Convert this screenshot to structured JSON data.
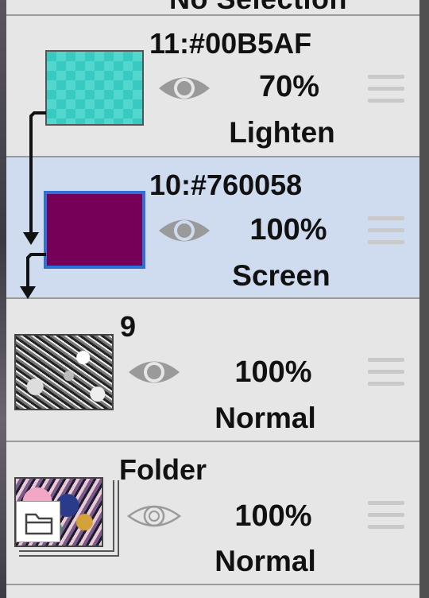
{
  "header_partial_text": "No Selection",
  "layers": [
    {
      "name": "11:#00B5AF",
      "opacity": "70%",
      "blend": "Lighten",
      "swatch": "#38c9c0",
      "selected": false,
      "visible": true,
      "clipped": true
    },
    {
      "name": "10:#760058",
      "opacity": "100%",
      "blend": "Screen",
      "swatch": "#760058",
      "selected": true,
      "visible": true,
      "clipped": true
    },
    {
      "name": "9",
      "opacity": "100%",
      "blend": "Normal",
      "selected": false,
      "visible": true,
      "clipped": false
    },
    {
      "name": "Folder",
      "opacity": "100%",
      "blend": "Normal",
      "selected": false,
      "visible": true,
      "type": "folder"
    }
  ],
  "icons": {
    "visibility": "eye-icon",
    "reorder": "drag-handle-icon",
    "folder": "folder-icon",
    "clipping": "clip-arrow-icon"
  },
  "colors": {
    "selected_row": "#cfdbef",
    "row": "#e6e6e6",
    "selection_border": "#2f6fd6"
  }
}
